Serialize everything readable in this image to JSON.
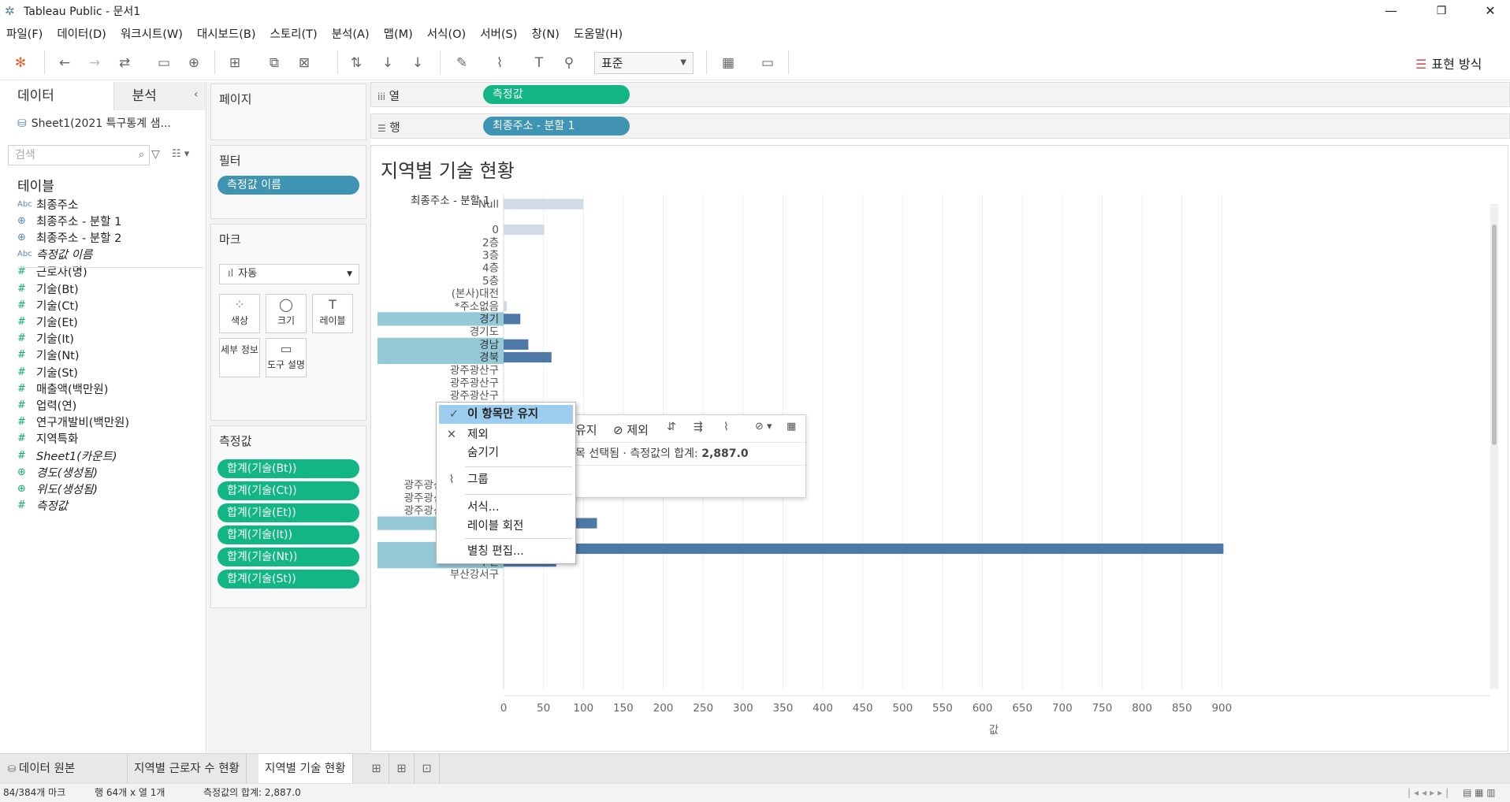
{
  "window": {
    "title": "Tableau Public - 문서1",
    "controls": {
      "minimize": "—",
      "restore": "❐",
      "close": "✕"
    }
  },
  "menu": [
    "파일(F)",
    "데이터(D)",
    "워크시트(W)",
    "대시보드(B)",
    "스토리(T)",
    "분석(A)",
    "맵(M)",
    "서식(O)",
    "서버(S)",
    "창(N)",
    "도움말(H)"
  ],
  "toolbar": {
    "fit_select": "표준",
    "show_me": "표현 방식"
  },
  "data_pane": {
    "tab_data": "데이터",
    "tab_analysis": "분석",
    "datasource": "Sheet1(2021 특구통계 샘...",
    "search_placeholder": "검색",
    "tables_label": "테이블",
    "fields": [
      {
        "name": "최종주소",
        "type": "abc"
      },
      {
        "name": "최종주소 - 분할 1",
        "type": "geo"
      },
      {
        "name": "최종주소 - 분할 2",
        "type": "geo"
      },
      {
        "name": "측정값 이름",
        "type": "abc",
        "italic": true
      },
      {
        "name": "근로자(명)",
        "type": "num"
      },
      {
        "name": "기술(Bt)",
        "type": "num"
      },
      {
        "name": "기술(Ct)",
        "type": "num"
      },
      {
        "name": "기술(Et)",
        "type": "num"
      },
      {
        "name": "기술(It)",
        "type": "num"
      },
      {
        "name": "기술(Nt)",
        "type": "num"
      },
      {
        "name": "기술(St)",
        "type": "num"
      },
      {
        "name": "매출액(백만원)",
        "type": "num"
      },
      {
        "name": "업력(연)",
        "type": "num"
      },
      {
        "name": "연구개발비(백만원)",
        "type": "num"
      },
      {
        "name": "지역특화",
        "type": "num"
      },
      {
        "name": "Sheet1(카운트)",
        "type": "num",
        "italic": true
      },
      {
        "name": "경도(생성됨)",
        "type": "geog",
        "italic": true
      },
      {
        "name": "위도(생성됨)",
        "type": "geog",
        "italic": true
      },
      {
        "name": "측정값",
        "type": "num",
        "italic": true
      }
    ]
  },
  "cards": {
    "pages_title": "페이지",
    "filters_title": "필터",
    "filter_pill": "측정값 이름",
    "marks_title": "마크",
    "mark_type": "자동",
    "mark_buttons": [
      "색상",
      "크기",
      "레이블",
      "세부 정보",
      "도구 설명"
    ],
    "measures_title": "측정값",
    "measure_pills": [
      "합계(기술(Bt))",
      "합계(기술(Ct))",
      "합계(기술(Et))",
      "합계(기술(It))",
      "합계(기술(Nt))",
      "합계(기술(St))"
    ]
  },
  "shelves": {
    "columns_label": "열",
    "columns_pill": "측정값",
    "rows_label": "행",
    "rows_pill": "최종주소 - 분할 1"
  },
  "viz": {
    "title": "지역별 기술 현황",
    "row_header": "최종주소 - 분할 1",
    "axis_label": "값"
  },
  "chart_data": {
    "type": "bar",
    "orientation": "horizontal",
    "categories": [
      "Null",
      "",
      "0",
      "2층",
      "3층",
      "4층",
      "5층",
      "(본사)대전",
      "*주소없음",
      "경기",
      "경기도",
      "경남",
      "경북",
      "광주광산구",
      "광주광산구",
      "광주광산구",
      "광주광산구",
      "광주광산구",
      "광주광산구",
      "광주광산구",
      "광주광산구",
      "광주광산구",
      "광주광산구진곡산단..",
      "광주광산구진곡산단..",
      "광주광산구진곡산단..",
      "대구",
      "대구광역시",
      "대전",
      "부산",
      "부산강서구"
    ],
    "values": [
      100,
      null,
      51,
      0,
      0,
      0,
      0,
      0,
      4,
      21,
      0,
      31,
      60,
      0,
      0,
      0,
      0,
      0,
      0,
      0,
      0,
      0,
      0,
      0,
      0,
      117,
      0,
      902,
      66,
      0
    ],
    "highlighted": [
      "경기",
      "경남",
      "경북",
      "대구",
      "대전",
      "부산"
    ],
    "xlim": [
      0,
      950
    ],
    "xticks": [
      0,
      50,
      100,
      150,
      200,
      250,
      300,
      350,
      400,
      450,
      500,
      550,
      600,
      650,
      700,
      750,
      800,
      850,
      900
    ],
    "xlabel": "값",
    "colors": {
      "selected": "#4e79a7",
      "unselected": "#d0dbe5",
      "highlight_band": "#95c9d8"
    }
  },
  "action_tooltip": {
    "keep_only": "유지",
    "exclude": "제외",
    "summary_prefix": "목 선택됨 · 측정값의 합계: ",
    "summary_value": "2,887.0"
  },
  "context_menu": {
    "items": [
      "이 항목만 유지",
      "제외",
      "숨기기",
      "그룹",
      "서식...",
      "레이블 회전",
      "별칭 편집..."
    ]
  },
  "sheet_tabs": {
    "data_source": "데이터 원본",
    "tabs": [
      "지역별 근로자 수 현황",
      "지역별 기술 현황"
    ]
  },
  "status": {
    "marks": "84/384개 마크",
    "dims": "행 64개 x 열 1개",
    "sum": "측정값의 합계: 2,887.0"
  }
}
